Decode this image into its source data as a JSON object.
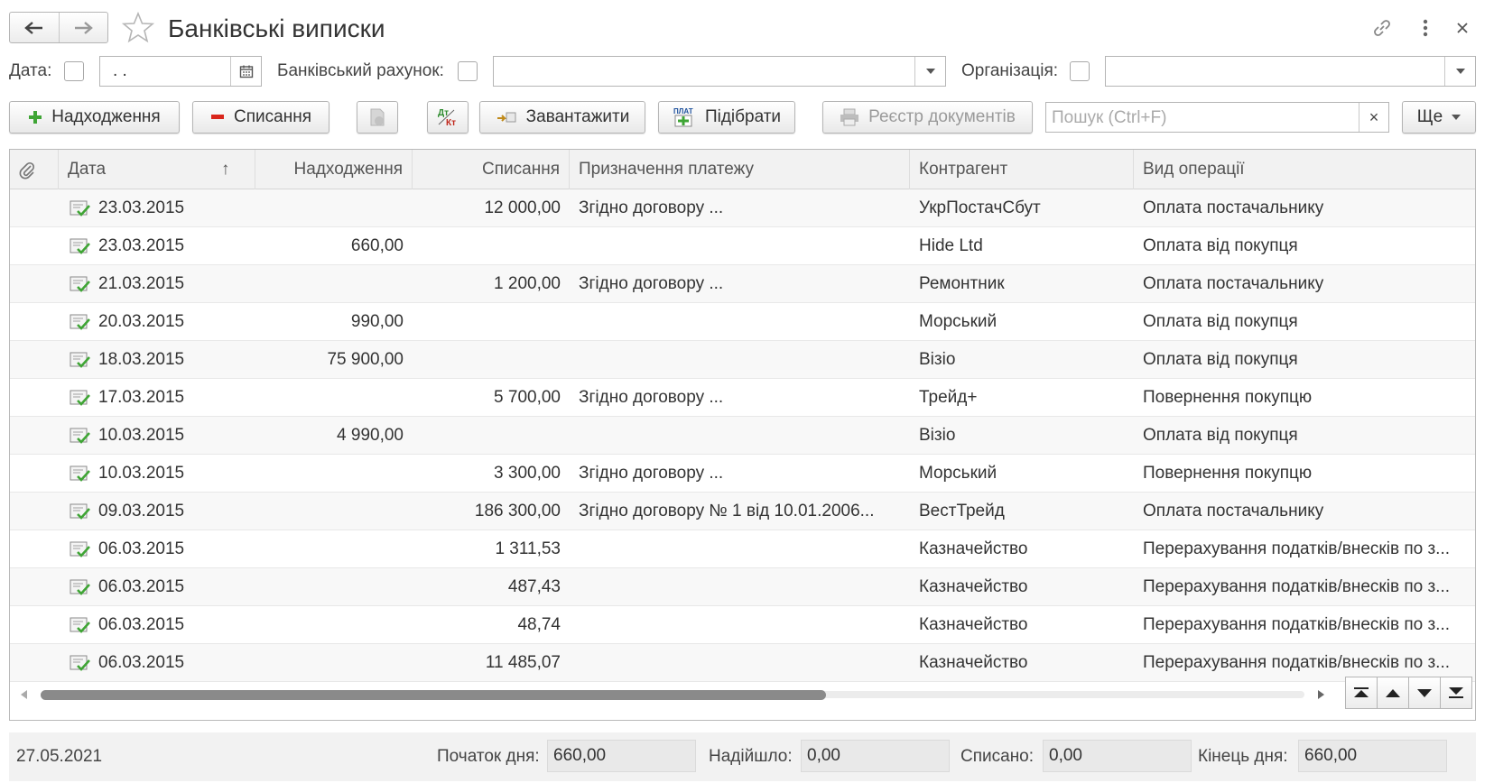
{
  "window": {
    "title": "Банківські виписки"
  },
  "filters": {
    "date_label": "Дата:",
    "date_value": " .  .",
    "account_label": "Банківський рахунок:",
    "account_value": "",
    "org_label": "Організація:",
    "org_value": ""
  },
  "toolbar": {
    "income_label": "Надходження",
    "expense_label": "Списання",
    "load_label": "Завантажити",
    "select_label": "Підібрати",
    "register_label": "Реєстр документів",
    "search_placeholder": "Пошук (Ctrl+F)",
    "more_label": "Ще"
  },
  "table": {
    "columns": [
      "Дата",
      "Надходження",
      "Списання",
      "Призначення платежу",
      "Контрагент",
      "Вид операції"
    ],
    "rows": [
      {
        "date": "23.03.2015",
        "income": "",
        "expense": "12 000,00",
        "purpose": "Згідно договору ...",
        "counterparty": "УкрПостачСбут",
        "operation": "Оплата постачальнику"
      },
      {
        "date": "23.03.2015",
        "income": "660,00",
        "expense": "",
        "purpose": "",
        "counterparty": "Hide Ltd",
        "operation": "Оплата від покупця"
      },
      {
        "date": "21.03.2015",
        "income": "",
        "expense": "1 200,00",
        "purpose": "Згідно договору ...",
        "counterparty": "Ремонтник",
        "operation": "Оплата постачальнику"
      },
      {
        "date": "20.03.2015",
        "income": "990,00",
        "expense": "",
        "purpose": "",
        "counterparty": "Морський",
        "operation": "Оплата від покупця"
      },
      {
        "date": "18.03.2015",
        "income": "75 900,00",
        "expense": "",
        "purpose": "",
        "counterparty": "Візіо",
        "operation": "Оплата від покупця"
      },
      {
        "date": "17.03.2015",
        "income": "",
        "expense": "5 700,00",
        "purpose": "Згідно договору ...",
        "counterparty": "Трейд+",
        "operation": "Повернення покупцю"
      },
      {
        "date": "10.03.2015",
        "income": "4 990,00",
        "expense": "",
        "purpose": "",
        "counterparty": "Візіо",
        "operation": "Оплата від покупця"
      },
      {
        "date": "10.03.2015",
        "income": "",
        "expense": "3 300,00",
        "purpose": "Згідно договору ...",
        "counterparty": "Морський",
        "operation": "Повернення покупцю"
      },
      {
        "date": "09.03.2015",
        "income": "",
        "expense": "186 300,00",
        "purpose": "Згідно договору № 1 від 10.01.2006...",
        "counterparty": "ВестТрейд",
        "operation": "Оплата постачальнику"
      },
      {
        "date": "06.03.2015",
        "income": "",
        "expense": "1 311,53",
        "purpose": "",
        "counterparty": "Казначейство",
        "operation": "Перерахування податків/внесків по з..."
      },
      {
        "date": "06.03.2015",
        "income": "",
        "expense": "487,43",
        "purpose": "",
        "counterparty": "Казначейство",
        "operation": "Перерахування податків/внесків по з..."
      },
      {
        "date": "06.03.2015",
        "income": "",
        "expense": "48,74",
        "purpose": "",
        "counterparty": "Казначейство",
        "operation": "Перерахування податків/внесків по з..."
      },
      {
        "date": "06.03.2015",
        "income": "",
        "expense": "11 485,07",
        "purpose": "",
        "counterparty": "Казначейство",
        "operation": "Перерахування податків/внесків по з..."
      }
    ]
  },
  "footer": {
    "date": "27.05.2021",
    "start_label": "Початок дня:",
    "start_value": "660,00",
    "in_label": "Надійшло:",
    "in_value": "0,00",
    "out_label": "Списано:",
    "out_value": "0,00",
    "end_label": "Кінець дня:",
    "end_value": "660,00"
  },
  "colors": {
    "accent_green": "#3fa535",
    "accent_red": "#d9261c",
    "header_bg": "#f2f2f2"
  }
}
